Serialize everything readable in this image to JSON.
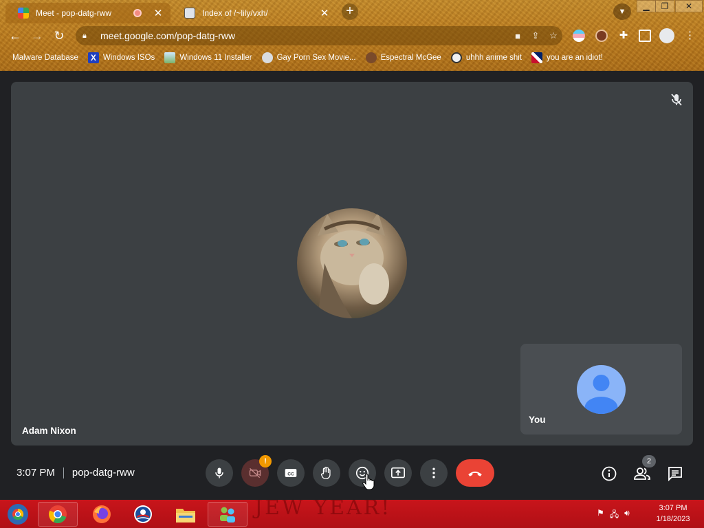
{
  "browser": {
    "tabs": [
      {
        "title": "Meet - pop-datg-rww",
        "active": true,
        "favicon": "meet-icon",
        "recording": true
      },
      {
        "title": "Index of /~lily/vxh/",
        "active": false,
        "favicon": "page-icon"
      }
    ],
    "url": "meet.google.com/pop-datg-rww",
    "bookmarks": [
      {
        "label": "Malware Database",
        "icon": "folder-icon"
      },
      {
        "label": "Windows ISOs",
        "icon": "x-logo-icon"
      },
      {
        "label": "Windows 11 Installer",
        "icon": "image-icon"
      },
      {
        "label": "Gay Porn Sex Movie...",
        "icon": "globe-icon"
      },
      {
        "label": "Espectral McGee",
        "icon": "face-icon"
      },
      {
        "label": "uhhh anime shit",
        "icon": "anime-icon"
      },
      {
        "label": "you are an idiot!",
        "icon": "flag-icon"
      }
    ]
  },
  "meet": {
    "main_participant": "Adam Nixon",
    "self_label": "You",
    "time": "3:07 PM",
    "meeting_code": "pop-datg-rww",
    "warning_badge": "!",
    "participant_count": "2",
    "colors": {
      "end_call": "#ea4335",
      "stage": "#3c4043",
      "self_avatar": "#8ab4f8",
      "warning": "#f29900"
    }
  },
  "taskbar": {
    "clock_time": "3:07 PM",
    "clock_date": "1/18/2023",
    "wallpaper_text": "JEW YEAR!",
    "apps": [
      "start-orb-icon",
      "chrome-icon",
      "firefox-icon",
      "opera-icon",
      "file-explorer-icon",
      "people-app-icon"
    ]
  }
}
